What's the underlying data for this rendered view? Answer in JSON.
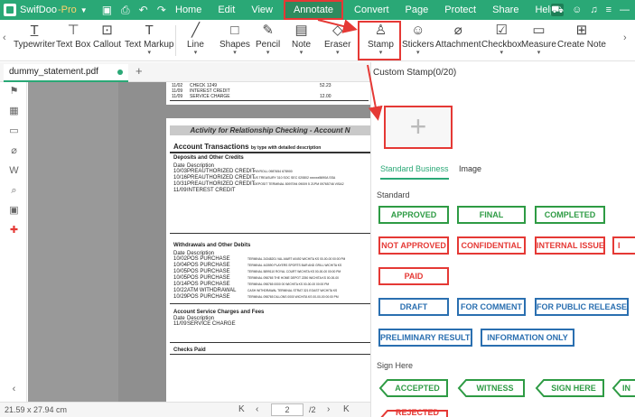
{
  "app": {
    "name": "SwifDoo",
    "edition": "Pro"
  },
  "menus": [
    "Home",
    "Edit",
    "View",
    "Annotate",
    "Convert",
    "Page",
    "Protect",
    "Share",
    "Help"
  ],
  "active_menu": "Annotate",
  "tools": [
    "Typewriter",
    "Text Box",
    "Callout",
    "Text Markup",
    "Line",
    "Shapes",
    "Pencil",
    "Note",
    "Eraser",
    "Stamp",
    "Stickers",
    "Attachment",
    "Checkbox",
    "Measure",
    "Create Note"
  ],
  "tab": {
    "filename": "dummy_statement.pdf"
  },
  "doc": {
    "top_rows": [
      [
        "11/02",
        "CHECK 1249",
        "52.23"
      ],
      [
        "11/09",
        "INTEREST CREDIT",
        ""
      ],
      [
        "11/09",
        "SERVICE CHARGE",
        "12.00"
      ]
    ],
    "title": "Activity for Relationship Checking - Account N",
    "section1_title": "Account Transactions",
    "section1_sub": "by type with detailed description",
    "deposits_header": "Deposits and Other Credits",
    "col_date": "Date",
    "col_desc": "Description",
    "deposits": [
      [
        "10/03",
        "PREAUTHORIZED CREDIT",
        "PAYROLL 0987654 678900"
      ],
      [
        "10/16",
        "PREAUTHORIZED CREDIT",
        "US TREASURY 310 SOC SEC 020802 xxxxxx5690A SSA"
      ],
      [
        "10/31",
        "PREAUTHORIZED CREDIT",
        "DEPOSIT TERMINAL 8097094 09009 5 21PM 09765746 VISA2"
      ],
      [
        "11/09",
        "INTEREST CREDIT",
        ""
      ]
    ],
    "withdrawals_header": "Withdrawals and Other Debits",
    "withdrawals": [
      [
        "10/02",
        "POS PURCHASE",
        "TERMINAL 24348201 VAL-MART #0492 WICHITA KS 00-00-00 00:00 PM"
      ],
      [
        "10/04",
        "POS PURCHASE",
        "TERMINAL 443590 PLAYERS SPORTS BAR AND GRILL WICHITA KS"
      ],
      [
        "10/05",
        "POS PURCHASE",
        "TERMINAL 5899110 ROYAL COURT WICHITA KS 00-00-00 00:00 PM"
      ],
      [
        "10/05",
        "POS PURCHASE",
        "TERMINAL 098765 THE HOME DEPOT 2250 WICHITA KS 00-00-00"
      ],
      [
        "10/14",
        "POS PURCHASE",
        "TERMINAL 098765 0000 00 WICHITA KS 00-00-00 00:00 PM"
      ],
      [
        "10/22",
        "ATM WITHDRAWAL",
        "CASH WITHDRAWAL TERMINAL STRAT 321 EOAST WICHITA KS"
      ],
      [
        "10/29",
        "POS PURCHASE",
        "TERMINAL 098765 DILLONS 0000 WICHITA KS 00-00-00 00:00 PM"
      ]
    ],
    "service_header": "Account Service Charges and Fees",
    "service_rows": [
      [
        "11/09",
        "SERVICE CHARGE"
      ]
    ],
    "checks_header": "Checks Paid"
  },
  "status": {
    "dims": "21.59 x 27.94 cm",
    "page": "2",
    "total": "/2"
  },
  "panel": {
    "custom_title": "Custom Stamp(0/20)",
    "tabs": [
      "Standard Business",
      "Image"
    ],
    "section_standard": "Standard",
    "section_sign": "Sign Here",
    "stamps_green": [
      "APPROVED",
      "FINAL",
      "COMPLETED"
    ],
    "stamps_red": [
      "NOT APPROVED",
      "CONFIDENTIAL",
      "INTERNAL ISSUE",
      "I"
    ],
    "stamps_red2": [
      "PAID"
    ],
    "stamps_blue": [
      "DRAFT",
      "FOR COMMENT",
      "FOR PUBLIC RELEASE"
    ],
    "stamps_blue2": [
      "PRELIMINARY RESULTS",
      "INFORMATION ONLY"
    ],
    "sign_stamps": [
      "ACCEPTED",
      "WITNESS",
      "SIGN HERE",
      "IN"
    ],
    "partial_bottom": "REJECTED"
  },
  "colors": {
    "brand": "#2aa876",
    "highlight": "#e53935",
    "stamp_green": "#2e9b44",
    "stamp_red": "#e53935",
    "stamp_blue": "#2a6fb0"
  }
}
